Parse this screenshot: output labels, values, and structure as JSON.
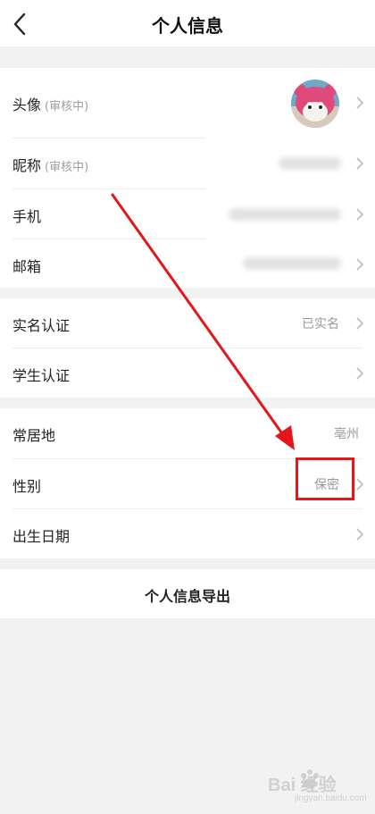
{
  "header": {
    "title": "个人信息"
  },
  "profile": {
    "avatar_label": "头像",
    "avatar_status": "(审核中)",
    "nickname_label": "昵称",
    "nickname_status": "(审核中)",
    "phone_label": "手机",
    "email_label": "邮箱"
  },
  "verification": {
    "real_name_label": "实名认证",
    "real_name_value": "已实名",
    "student_label": "学生认证"
  },
  "personal": {
    "residence_label": "常居地",
    "residence_value": "亳州",
    "gender_label": "性别",
    "gender_value": "保密",
    "birthday_label": "出生日期"
  },
  "export": {
    "label": "个人信息导出"
  },
  "watermark": {
    "brand": "Bai 经验",
    "url": "jingyan.baidu.com"
  },
  "colors": {
    "annotation_red": "#e5161b"
  }
}
